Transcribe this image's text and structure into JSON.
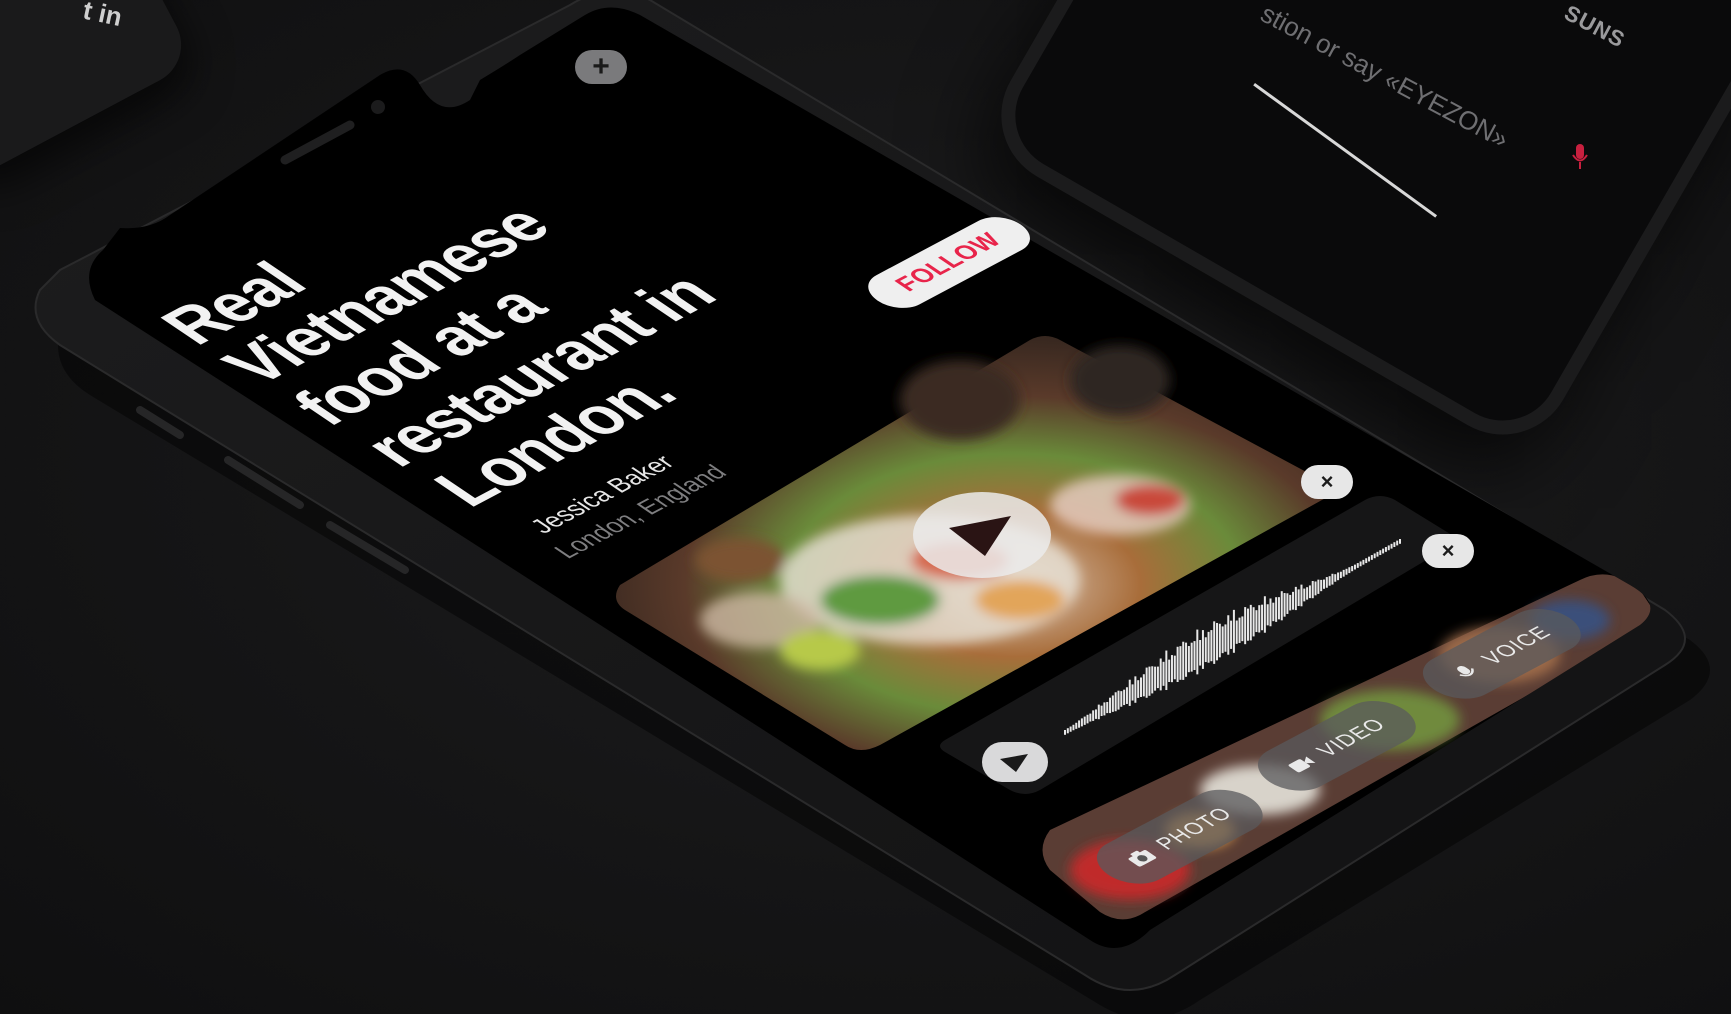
{
  "post": {
    "headline_lines": [
      "Real",
      "Vietnamese",
      "food at a",
      "restaurant in",
      "London."
    ],
    "author_name": "Jessica Baker",
    "author_location": "London, England",
    "follow_label": "FOLLOW"
  },
  "controls": {
    "add_symbol": "+",
    "close_symbol": "×"
  },
  "recorder": {
    "photo_label": "PHOTO",
    "video_label": "VIDEO",
    "voice_label": "VOICE"
  },
  "background_phones": {
    "left_fragment": "t in",
    "right_prompt": "stion or say «EYEZON»",
    "right_sun": "SUNS"
  },
  "colors": {
    "accent": "#e8244a",
    "screen": "#000000",
    "text": "#f2f2f2",
    "muted": "#7e7e80"
  },
  "icons": [
    "plus-icon",
    "close-icon",
    "play-icon",
    "camera-icon",
    "video-camera-icon",
    "microphone-icon"
  ]
}
